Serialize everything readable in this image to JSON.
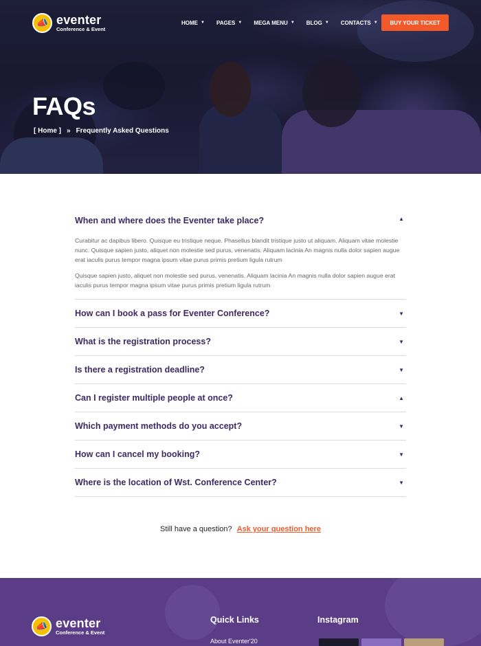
{
  "brand": {
    "name": "eventer",
    "tagline": "Conference & Event",
    "badge_glyph": "📣"
  },
  "nav": {
    "items": [
      {
        "label": "HOME"
      },
      {
        "label": "PAGES"
      },
      {
        "label": "MEGA MENU"
      },
      {
        "label": "BLOG"
      },
      {
        "label": "CONTACTS"
      }
    ],
    "ticket_label": "BUY YOUR TICKET"
  },
  "hero": {
    "title": "FAQs",
    "breadcrumb": {
      "home": "[ Home ]",
      "separator": "»",
      "current": "Frequently Asked Questions"
    }
  },
  "faq": {
    "items": [
      {
        "question": "When and where does the Eventer take place?",
        "expanded": true,
        "answer": [
          "Curabitur ac dapibus libero. Quisque eu tristique neque. Phasellus blandit tristique justo ut aliquam. Aliquam vitae molestie nunc. Quisque sapien justo, aliquet non molestie sed purus, venenatis. Aliquam lacinia An magnis nulla dolor sapien augue erat iaculis purus tempor magna ipsum vitae purus primis pretium ligula rutrum",
          "Quisque sapien justo, aliquet non molestie sed purus, venenatis. Aliquam lacinia An magnis nulla dolor sapien augue erat iaculis purus tempor magna ipsum vitae purus primis pretium ligula rutrum"
        ]
      },
      {
        "question": "How can I book a pass for Eventer Conference?",
        "expanded": false
      },
      {
        "question": "What is the registration process?",
        "expanded": false
      },
      {
        "question": "Is there a registration deadline?",
        "expanded": false
      },
      {
        "question": "Can I register multiple people at once?",
        "expanded": true
      },
      {
        "question": "Which payment methods do you accept?",
        "expanded": false
      },
      {
        "question": "How can I cancel my booking?",
        "expanded": false
      },
      {
        "question": "Where is the location of Wst. Conference Center?",
        "expanded": false
      }
    ]
  },
  "help": {
    "prompt": "Still have a question?",
    "link": "Ask your question here"
  },
  "footer": {
    "quick_links_title": "Quick Links",
    "quick_links": [
      "About Eventer'20"
    ],
    "instagram_title": "Instagram"
  },
  "colors": {
    "accent": "#f1592a",
    "heading": "#3b2a63",
    "footer_bg": "#5a3d86"
  },
  "icons": {
    "caret": "caret-down-icon",
    "expanded": "chevron-up-icon",
    "collapsed": "chevron-down-icon"
  }
}
